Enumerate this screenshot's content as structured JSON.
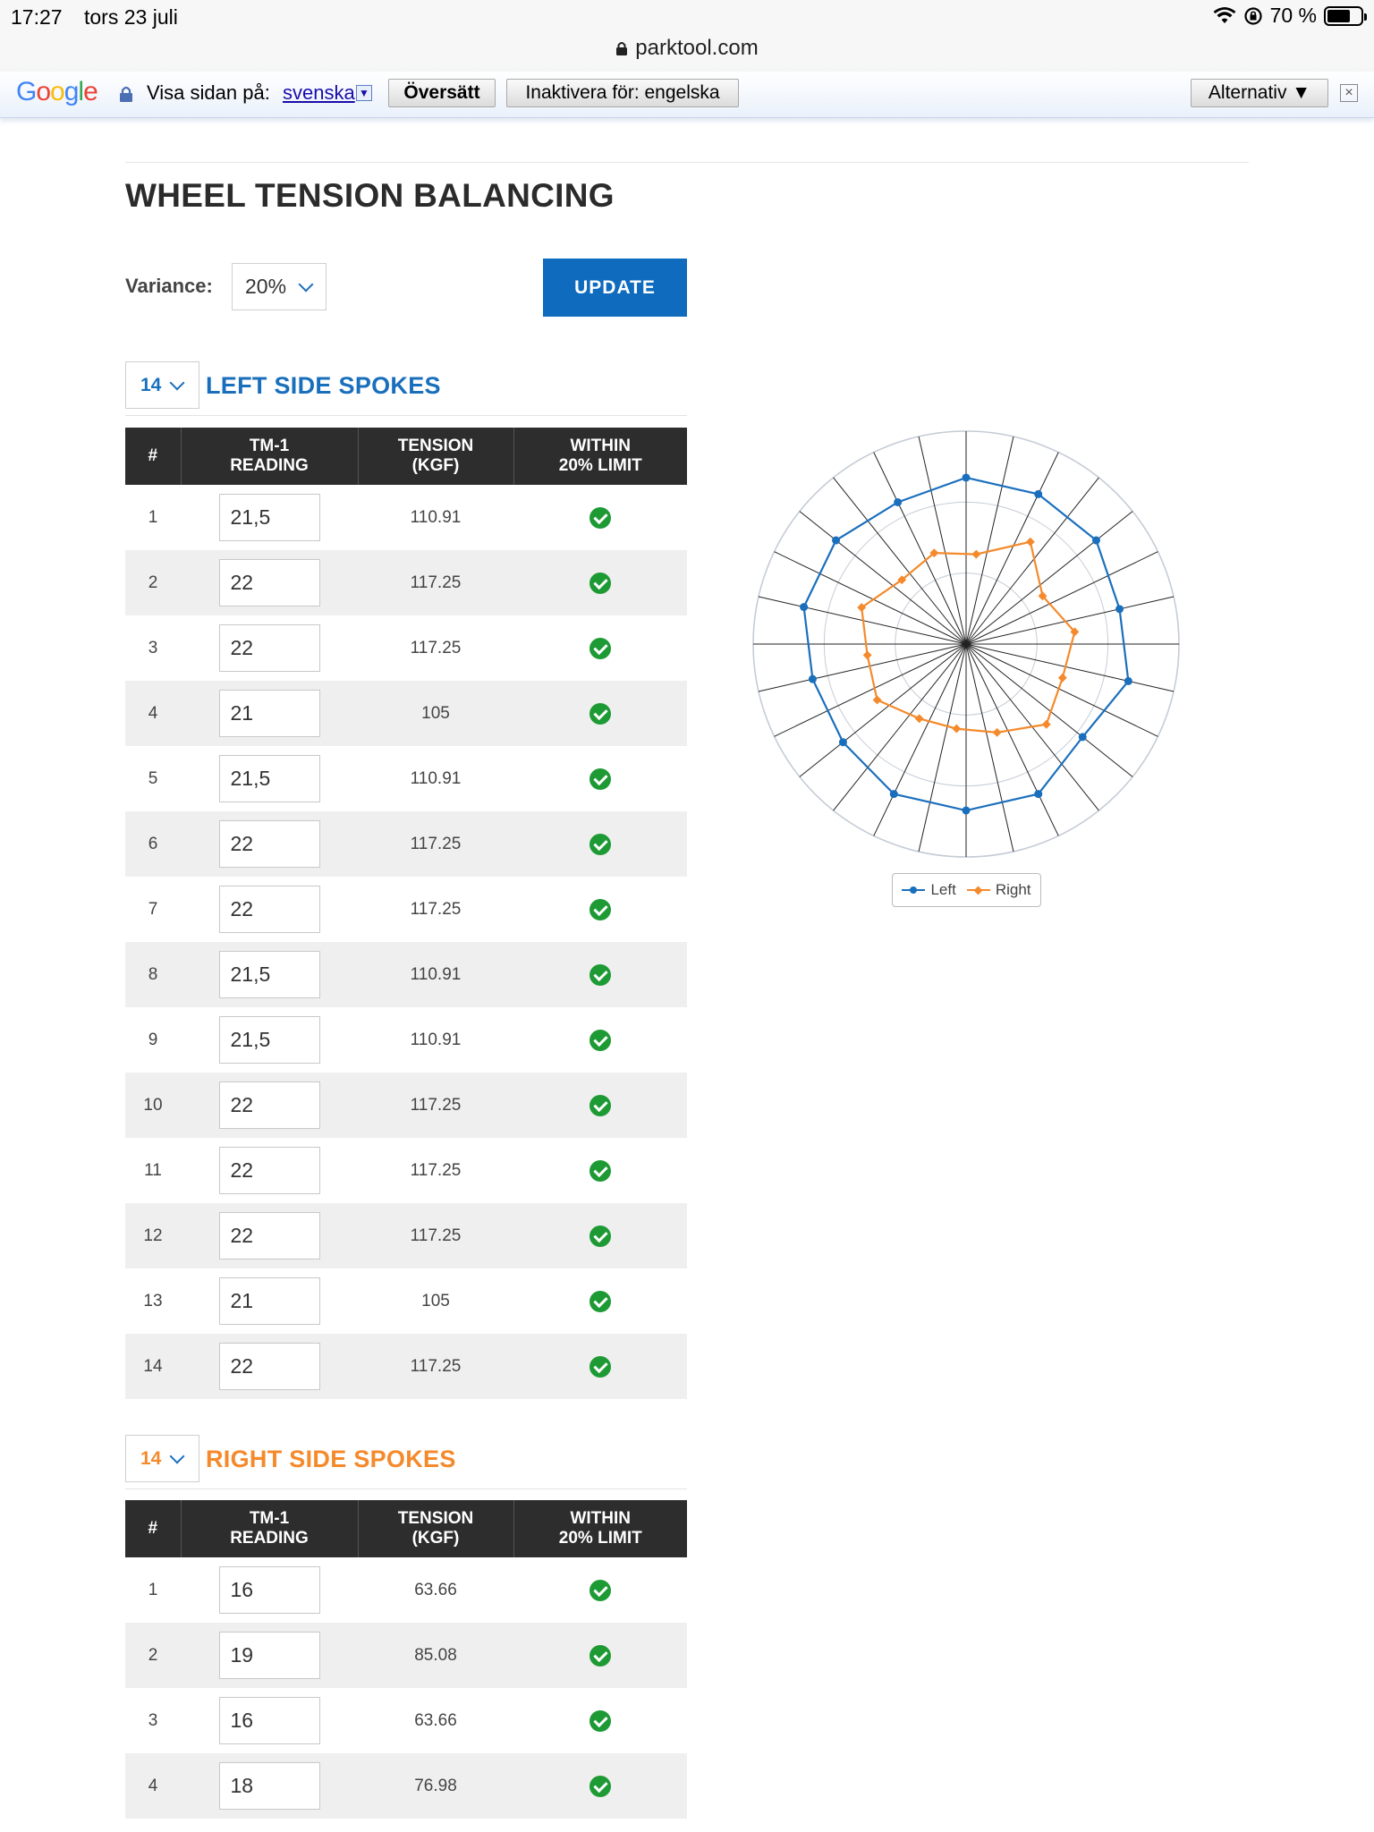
{
  "status_bar": {
    "time": "17:27",
    "date": "tors 23 juli",
    "battery": "70 %",
    "battery_level": 0.7
  },
  "browser": {
    "url": "parktool.com"
  },
  "translate_bar": {
    "logo": "Google",
    "prompt": "Visa sidan på:",
    "language": "svenska",
    "translate_button": "Översätt",
    "disable_button": "Inaktivera för: engelska",
    "options_button": "Alternativ ▼",
    "close": "×"
  },
  "page": {
    "title": "WHEEL TENSION BALANCING",
    "variance_label": "Variance:",
    "variance_value": "20%",
    "update_button": "UPDATE"
  },
  "table_headers": {
    "num": "#",
    "reading_1": "TM-1",
    "reading_2": "READING",
    "tension_1": "TENSION",
    "tension_2": "(KGF)",
    "limit_1": "WITHIN",
    "limit_2": "20% LIMIT"
  },
  "left_side": {
    "count": "14",
    "title": "LEFT SIDE SPOKES",
    "rows": [
      {
        "num": "1",
        "reading": "21,5",
        "tension": "110.91",
        "within": true
      },
      {
        "num": "2",
        "reading": "22",
        "tension": "117.25",
        "within": true
      },
      {
        "num": "3",
        "reading": "22",
        "tension": "117.25",
        "within": true
      },
      {
        "num": "4",
        "reading": "21",
        "tension": "105",
        "within": true
      },
      {
        "num": "5",
        "reading": "21,5",
        "tension": "110.91",
        "within": true
      },
      {
        "num": "6",
        "reading": "22",
        "tension": "117.25",
        "within": true
      },
      {
        "num": "7",
        "reading": "22",
        "tension": "117.25",
        "within": true
      },
      {
        "num": "8",
        "reading": "21,5",
        "tension": "110.91",
        "within": true
      },
      {
        "num": "9",
        "reading": "21,5",
        "tension": "110.91",
        "within": true
      },
      {
        "num": "10",
        "reading": "22",
        "tension": "117.25",
        "within": true
      },
      {
        "num": "11",
        "reading": "22",
        "tension": "117.25",
        "within": true
      },
      {
        "num": "12",
        "reading": "22",
        "tension": "117.25",
        "within": true
      },
      {
        "num": "13",
        "reading": "21",
        "tension": "105",
        "within": true
      },
      {
        "num": "14",
        "reading": "22",
        "tension": "117.25",
        "within": true
      }
    ]
  },
  "right_side": {
    "count": "14",
    "title": "RIGHT SIDE SPOKES",
    "rows": [
      {
        "num": "1",
        "reading": "16",
        "tension": "63.66",
        "within": true
      },
      {
        "num": "2",
        "reading": "19",
        "tension": "85.08",
        "within": true
      },
      {
        "num": "3",
        "reading": "16",
        "tension": "63.66",
        "within": true
      },
      {
        "num": "4",
        "reading": "18",
        "tension": "76.98",
        "within": true
      }
    ]
  },
  "chart_data": {
    "type": "radar",
    "spokes": 28,
    "rlim": [
      0,
      150
    ],
    "grid_rings": 3,
    "legend_position": "bottom",
    "series": [
      {
        "name": "Left",
        "color": "#1a6fbd",
        "values": [
          117.25,
          117.25,
          117.25,
          110.91,
          117.25,
          105,
          117.25,
          117.25,
          117.25,
          110.91,
          110.91,
          117.25,
          117.25,
          110.91
        ]
      },
      {
        "name": "Right",
        "color": "#f48a2c",
        "values": [
          63.66,
          85.08,
          63.66,
          76.98,
          72,
          80,
          66,
          60,
          62,
          74,
          70,
          78,
          64,
          68
        ]
      }
    ],
    "legend": [
      "Left",
      "Right"
    ],
    "colors": {
      "left": "#1a6fbd",
      "right": "#f48a2c",
      "spoke_line": "#222222",
      "ring": "#c5ccd6"
    }
  }
}
